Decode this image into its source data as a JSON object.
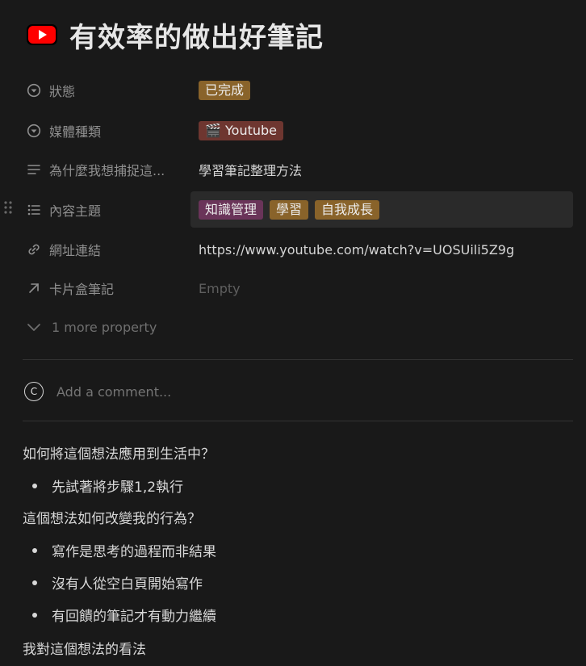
{
  "page": {
    "title": "有效率的做出好筆記",
    "icon": "youtube-icon"
  },
  "properties": [
    {
      "key": "狀態",
      "icon": "status-icon",
      "tags": [
        {
          "label": "已完成",
          "color": "#89632a"
        }
      ]
    },
    {
      "key": "媒體種類",
      "icon": "select-icon",
      "tags": [
        {
          "label": "🎬 Youtube",
          "color": "#6e3630"
        }
      ]
    },
    {
      "key": "為什麼我想捕捉這...",
      "icon": "text-lines-icon",
      "value": "學習筆記整理方法"
    },
    {
      "key": "內容主題",
      "icon": "list-icon",
      "tags": [
        {
          "label": "知識管理",
          "color": "#6a3459"
        },
        {
          "label": "學習",
          "color": "#89632a"
        },
        {
          "label": "自我成長",
          "color": "#89632a"
        }
      ]
    },
    {
      "key": "網址連結",
      "icon": "link-icon",
      "value": "https://www.youtube.com/watch?v=UOSUili5Z9g"
    },
    {
      "key": "卡片盒筆記",
      "icon": "arrow-up-right-icon",
      "value": "Empty"
    }
  ],
  "more_property": "1 more property",
  "comment": {
    "avatar_letter": "C",
    "placeholder": "Add a comment..."
  },
  "content": {
    "heading1": "如何將這個想法應用到生活中？",
    "bullets1": [
      "先試著將步驟1,2執行"
    ],
    "heading2": "這個想法如何改變我的行為？",
    "bullets2": [
      "寫作是思考的過程而非結果",
      "沒有人從空白頁開始寫作",
      "有回饋的筆記才有動力繼續"
    ],
    "heading3": "我對這個想法的看法"
  }
}
